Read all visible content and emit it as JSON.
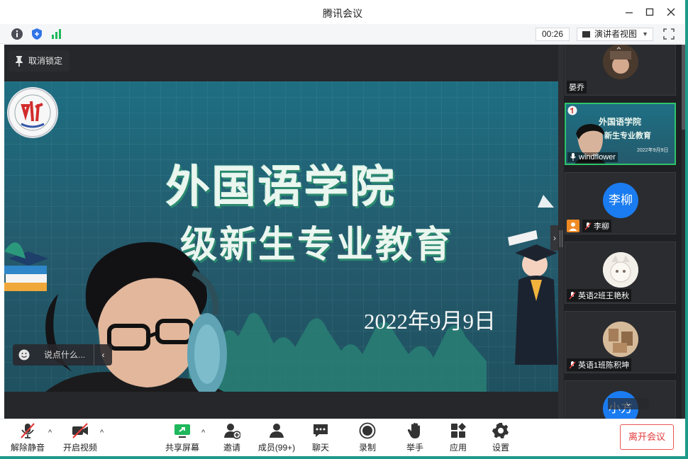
{
  "window": {
    "title": "腾讯会议"
  },
  "toolbar": {
    "timer": "00:26",
    "view_mode": "演讲者视图"
  },
  "stage": {
    "unpin_label": "取消锁定",
    "chat_placeholder": "说点什么...",
    "slide": {
      "title": "外国语学院",
      "subtitle": "级新生专业教育",
      "date": "2022年9月9日"
    }
  },
  "participants": [
    {
      "name": "晏乔",
      "type": "video"
    },
    {
      "name": "windflower",
      "type": "screen",
      "mini_title": "外国语学院",
      "mini_subtitle": "新生专业教育",
      "mini_date": "2022年9月9日"
    },
    {
      "name": "李柳",
      "type": "avatar",
      "avatar_text": "李柳",
      "muted": true
    },
    {
      "name": "英语2班王艳秋",
      "type": "avatar-image",
      "muted": true
    },
    {
      "name": "英语1班陈积坤",
      "type": "avatar-image",
      "muted": true
    },
    {
      "name": "",
      "type": "avatar",
      "avatar_text": "小方"
    }
  ],
  "bottom_bar": {
    "unmute": "解除静音",
    "start_video": "开启视频",
    "share_screen": "共享屏幕",
    "invite": "邀请",
    "members": "成员(99+)",
    "chat": "聊天",
    "record": "录制",
    "raise_hand": "举手",
    "apps": "应用",
    "settings": "设置",
    "leave": "离开会议"
  },
  "colors": {
    "accent_green": "#2ec46a",
    "leave_red": "#e33b3b",
    "avatar_blue": "#1a7cf0",
    "slide_bg": "#1e6e82"
  }
}
